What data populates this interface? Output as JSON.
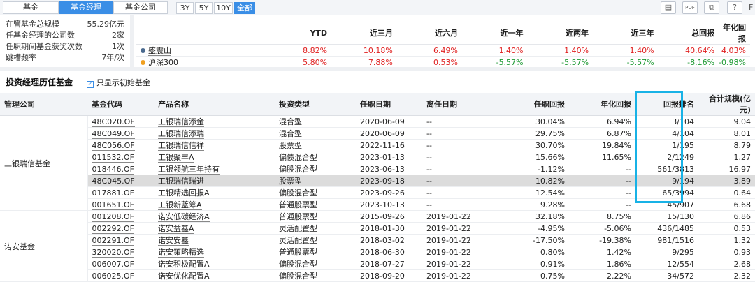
{
  "tabs": [
    "基金",
    "基金经理",
    "基金公司"
  ],
  "ranges": [
    "3Y",
    "5Y",
    "10Y",
    "全部"
  ],
  "tools": [
    "▤",
    "PDF",
    "⧉",
    "?"
  ],
  "tool_names": [
    "doc-icon",
    "pdf-icon",
    "copy-icon",
    "help-icon"
  ],
  "edge_label": "F",
  "summary": [
    {
      "label": "在管基金总规模",
      "value": "55.29亿元"
    },
    {
      "label": "任基金经理的公司数",
      "value": "2家"
    },
    {
      "label": "任职期间基金获奖次数",
      "value": "1次"
    },
    {
      "label": "跳槽频率",
      "value": "7年/次"
    }
  ],
  "perf": {
    "headers": [
      "YTD",
      "近三月",
      "近六月",
      "近一年",
      "近两年",
      "近三年",
      "总回报",
      "年化回报"
    ],
    "rows": [
      {
        "name": "盛震山",
        "dot": "#4a6a8f",
        "values": [
          "8.82%",
          "10.18%",
          "6.49%",
          "1.40%",
          "1.40%",
          "1.40%",
          "40.64%",
          "4.03%"
        ],
        "signs": [
          "pos",
          "pos",
          "pos",
          "pos",
          "pos",
          "pos",
          "pos",
          "pos"
        ]
      },
      {
        "name": "沪深300",
        "dot": "#f0a020",
        "values": [
          "5.80%",
          "7.88%",
          "0.53%",
          "-5.57%",
          "-5.57%",
          "-5.57%",
          "-8.16%",
          "-0.98%"
        ],
        "signs": [
          "pos",
          "pos",
          "pos",
          "neg",
          "neg",
          "neg",
          "neg",
          "neg"
        ]
      }
    ]
  },
  "history": {
    "title": "投资经理历任基金",
    "checkbox_label": "只显示初始基金",
    "headers": [
      "管理公司",
      "基金代码",
      "产品名称",
      "投资类型",
      "任职日期",
      "离任日期",
      "任职回报",
      "年化回报",
      "回报排名",
      "合计规模(亿元)"
    ],
    "groups": [
      {
        "company": "工银瑞信基金",
        "rows": [
          {
            "code": "48C020.OF",
            "name": "工银瑞信添金",
            "type": "混合型",
            "start": "2020-06-09",
            "end": "--",
            "ret": "30.04%",
            "ann": "6.94%",
            "rank": "3/104",
            "size": "9.04"
          },
          {
            "code": "48C049.OF",
            "name": "工银瑞信添瑞",
            "type": "混合型",
            "start": "2020-06-09",
            "end": "--",
            "ret": "29.75%",
            "ann": "6.87%",
            "rank": "4/104",
            "size": "8.01"
          },
          {
            "code": "48C056.OF",
            "name": "工银瑞信信祥",
            "type": "股票型",
            "start": "2022-11-16",
            "end": "--",
            "ret": "30.70%",
            "ann": "19.84%",
            "rank": "1/195",
            "size": "8.79"
          },
          {
            "code": "011532.OF",
            "name": "工银聚丰A",
            "type": "偏债混合型",
            "start": "2023-01-13",
            "end": "--",
            "ret": "15.66%",
            "ann": "11.65%",
            "rank": "2/1249",
            "size": "1.27"
          },
          {
            "code": "018446.OF",
            "name": "工银领航三年持有",
            "type": "偏股混合型",
            "start": "2023-06-13",
            "end": "--",
            "ret": "-1.12%",
            "ann": "--",
            "rank": "561/3813",
            "size": "16.97"
          },
          {
            "code": "48C045.OF",
            "name": "工银瑞信瑞进",
            "type": "股票型",
            "start": "2023-09-18",
            "end": "--",
            "ret": "10.82%",
            "ann": "--",
            "rank": "9/194",
            "size": "3.89",
            "highlight": true
          },
          {
            "code": "017881.OF",
            "name": "工银精选回报A",
            "type": "偏股混合型",
            "start": "2023-09-26",
            "end": "--",
            "ret": "12.54%",
            "ann": "--",
            "rank": "65/3994",
            "size": "0.64"
          },
          {
            "code": "001651.OF",
            "name": "工银新蓝筹A",
            "type": "普通股票型",
            "start": "2023-10-13",
            "end": "--",
            "ret": "9.28%",
            "ann": "--",
            "rank": "45/907",
            "size": "6.68"
          }
        ]
      },
      {
        "company": "诺安基金",
        "rows": [
          {
            "code": "001208.OF",
            "name": "诺安低碳经济A",
            "type": "普通股票型",
            "start": "2015-09-26",
            "end": "2019-01-22",
            "ret": "32.18%",
            "ann": "8.75%",
            "rank": "15/130",
            "size": "6.86"
          },
          {
            "code": "002292.OF",
            "name": "诺安益鑫A",
            "type": "灵活配置型",
            "start": "2018-01-30",
            "end": "2019-01-22",
            "ret": "-4.95%",
            "ann": "-5.06%",
            "rank": "436/1485",
            "size": "0.53"
          },
          {
            "code": "002291.OF",
            "name": "诺安安鑫",
            "type": "灵活配置型",
            "start": "2018-03-02",
            "end": "2019-01-22",
            "ret": "-17.50%",
            "ann": "-19.38%",
            "rank": "981/1516",
            "size": "1.32"
          },
          {
            "code": "320020.OF",
            "name": "诺安策略精选",
            "type": "普通股票型",
            "start": "2018-06-30",
            "end": "2019-01-22",
            "ret": "0.80%",
            "ann": "1.42%",
            "rank": "9/295",
            "size": "0.93"
          },
          {
            "code": "006007.OF",
            "name": "诺安积极配置A",
            "type": "偏股混合型",
            "start": "2018-07-27",
            "end": "2019-01-22",
            "ret": "0.91%",
            "ann": "1.86%",
            "rank": "12/554",
            "size": "2.68"
          },
          {
            "code": "006025.OF",
            "name": "诺安优化配置A",
            "type": "偏股混合型",
            "start": "2018-09-20",
            "end": "2019-01-22",
            "ret": "0.75%",
            "ann": "2.22%",
            "rank": "34/572",
            "size": "2.32"
          }
        ]
      }
    ]
  },
  "colors": {
    "accent": "#3a8ee6",
    "highlight_box": "#18b2e6",
    "positive": "#e02020",
    "negative": "#1d9a33"
  }
}
